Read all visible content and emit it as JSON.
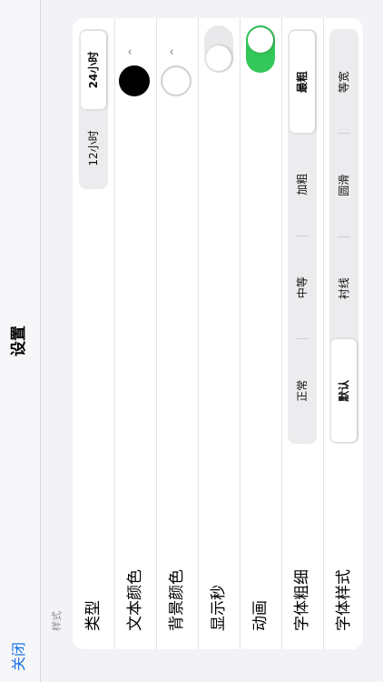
{
  "nav": {
    "close_label": "关闭",
    "title": "设置"
  },
  "section": {
    "header": "样式"
  },
  "rows": {
    "type": {
      "label": "类型",
      "options": [
        "12小时",
        "24小时"
      ],
      "selected": "24小时"
    },
    "text_color": {
      "label": "文本颜色",
      "color": "#000000",
      "chevron_icon": "chevron-up-icon"
    },
    "background_color": {
      "label": "背景颜色",
      "color": "#ffffff",
      "chevron_icon": "chevron-up-icon"
    },
    "show_seconds": {
      "label": "显示秒",
      "on": false
    },
    "animation": {
      "label": "动画",
      "on": true
    },
    "font_weight": {
      "label": "字体粗细",
      "options": [
        "正常",
        "中等",
        "加粗",
        "最粗"
      ],
      "selected": "最粗"
    },
    "font_style": {
      "label": "字体样式",
      "options": [
        "默认",
        "衬线",
        "圆滑",
        "等宽"
      ],
      "selected": "默认"
    }
  },
  "colors": {
    "accent": "#1a73e8",
    "toggle_on": "#34c759",
    "toggle_off": "#e9e9eb",
    "background": "#f2f2f7",
    "card": "#ffffff"
  }
}
